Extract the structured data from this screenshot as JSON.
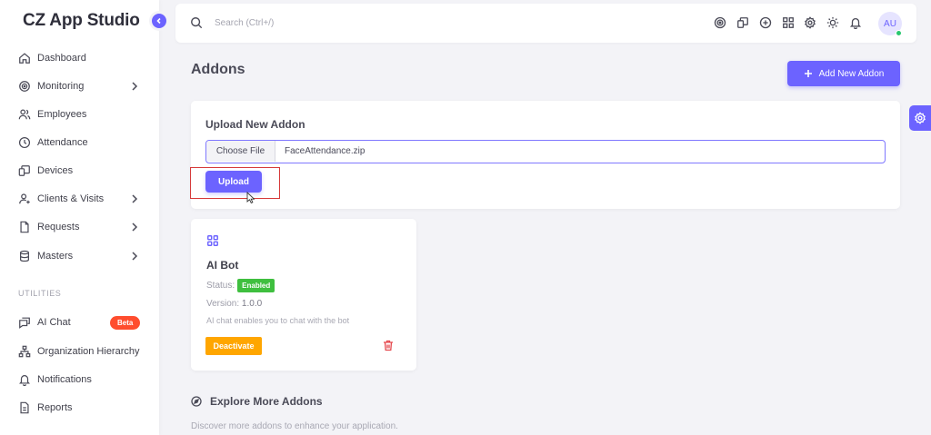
{
  "app": {
    "brand": "CZ App Studio"
  },
  "sidebar": {
    "items": [
      {
        "label": "Dashboard",
        "icon": "home-icon",
        "has_chevron": false
      },
      {
        "label": "Monitoring",
        "icon": "target-icon",
        "has_chevron": true
      },
      {
        "label": "Employees",
        "icon": "users-icon",
        "has_chevron": false
      },
      {
        "label": "Attendance",
        "icon": "clock-icon",
        "has_chevron": false
      },
      {
        "label": "Devices",
        "icon": "devices-icon",
        "has_chevron": false
      },
      {
        "label": "Clients & Visits",
        "icon": "user-icon",
        "has_chevron": true
      },
      {
        "label": "Requests",
        "icon": "file-icon",
        "has_chevron": true
      },
      {
        "label": "Masters",
        "icon": "database-icon",
        "has_chevron": true
      }
    ],
    "utilities_label": "UTILITIES",
    "utility_items": [
      {
        "label": "AI Chat",
        "icon": "chat-icon",
        "badge": "Beta"
      },
      {
        "label": "Organization Hierarchy",
        "icon": "hierarchy-icon"
      },
      {
        "label": "Notifications",
        "icon": "bell-icon"
      },
      {
        "label": "Reports",
        "icon": "report-icon"
      }
    ]
  },
  "topbar": {
    "search_placeholder": "Search (Ctrl+/)",
    "avatar_initials": "AU"
  },
  "page": {
    "title": "Addons",
    "add_button_label": "Add New Addon"
  },
  "upload": {
    "title": "Upload New Addon",
    "choose_file_label": "Choose File",
    "file_name": "FaceAttendance.zip",
    "upload_button_label": "Upload"
  },
  "addon": {
    "name": "AI Bot",
    "status_label": "Status:",
    "status_value": "Enabled",
    "version_label": "Version:",
    "version_value": "1.0.0",
    "description": "AI chat enables you to chat with the bot",
    "deactivate_label": "Deactivate"
  },
  "explore": {
    "title": "Explore More Addons",
    "subtitle": "Discover more addons to enhance your application."
  },
  "colors": {
    "accent": "#6c63ff",
    "enabled": "#3fbf3f",
    "warning": "#ffa600",
    "danger": "#e5484d",
    "beta": "#ff4d2e"
  }
}
